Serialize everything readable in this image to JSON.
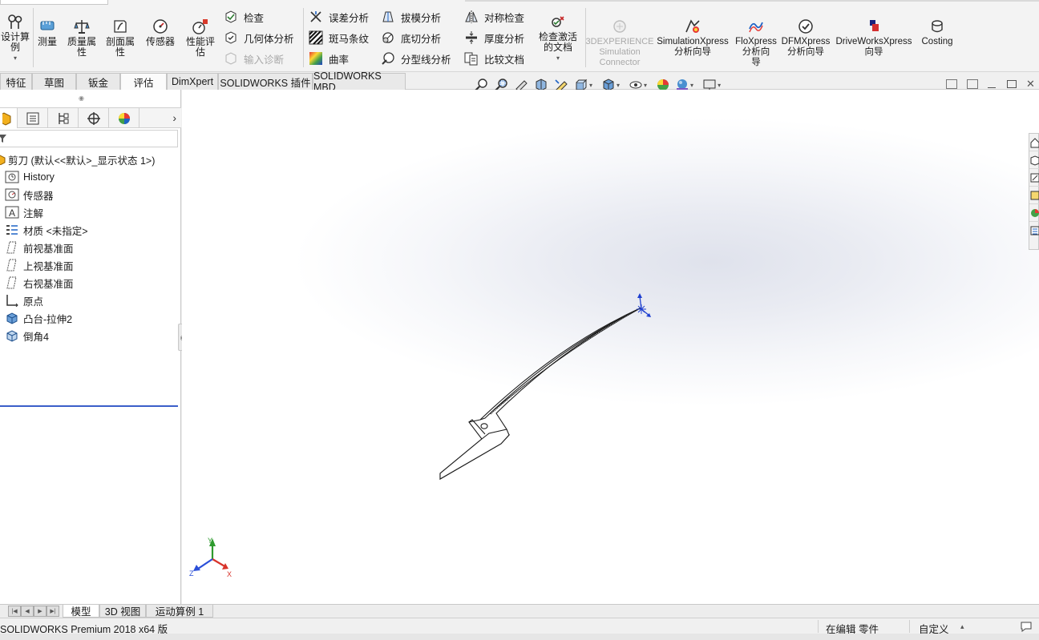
{
  "ribbon": {
    "large_buttons": [
      {
        "label": "设计算\n例",
        "icon": "design-study-icon"
      },
      {
        "label": "测量",
        "icon": "measure-icon"
      },
      {
        "label": "质量属\n性",
        "icon": "mass-properties-icon"
      },
      {
        "label": "剖面属\n性",
        "icon": "section-properties-icon"
      },
      {
        "label": "传感器",
        "icon": "sensor-icon"
      },
      {
        "label": "性能评\n估",
        "icon": "performance-evaluation-icon"
      }
    ],
    "small_buttons": [
      {
        "label": "检查",
        "icon": "check-icon",
        "enabled": true
      },
      {
        "label": "几何体分析",
        "icon": "geometry-analysis-icon",
        "enabled": true
      },
      {
        "label": "输入诊断",
        "icon": "import-diagnostics-icon",
        "enabled": false
      },
      {
        "label": "误差分析",
        "icon": "deviation-analysis-icon",
        "enabled": true
      },
      {
        "label": "斑马条纹",
        "icon": "zebra-stripes-icon",
        "enabled": true
      },
      {
        "label": "曲率",
        "icon": "curvature-icon",
        "enabled": true
      },
      {
        "label": "拔模分析",
        "icon": "draft-analysis-icon",
        "enabled": true
      },
      {
        "label": "底切分析",
        "icon": "undercut-analysis-icon",
        "enabled": true
      },
      {
        "label": "分型线分析",
        "icon": "parting-line-analysis-icon",
        "enabled": true
      },
      {
        "label": "对称检查",
        "icon": "symmetry-check-icon",
        "enabled": true
      },
      {
        "label": "厚度分析",
        "icon": "thickness-analysis-icon",
        "enabled": true
      },
      {
        "label": "比较文档",
        "icon": "compare-documents-icon",
        "enabled": true
      }
    ],
    "check_active_doc": "检查激活\n的文档",
    "right_buttons": [
      {
        "label": "3DEXPERIENCE\nSimulation\nConnector",
        "icon": "3dexperience-icon",
        "enabled": false
      },
      {
        "label": "SimulationXpress\n分析向导",
        "icon": "simulationxpress-icon",
        "enabled": true
      },
      {
        "label": "FloXpress\n分析向\n导",
        "icon": "floxpress-icon",
        "enabled": true
      },
      {
        "label": "DFMXpress\n分析向导",
        "icon": "dfmxpress-icon",
        "enabled": true
      },
      {
        "label": "DriveWorksXpress\n向导",
        "icon": "driveworksxpress-icon",
        "enabled": true
      },
      {
        "label": "Costing",
        "icon": "costing-icon",
        "enabled": true
      }
    ]
  },
  "tabs": [
    "特征",
    "草图",
    "钣金",
    "评估",
    "DimXpert",
    "SOLIDWORKS 插件",
    "SOLIDWORKS MBD"
  ],
  "active_tab": "评估",
  "tree": {
    "root": "剪刀 (默认<<默认>_显示状态 1>)",
    "items": [
      {
        "label": "History",
        "icon": "history-icon"
      },
      {
        "label": "传感器",
        "icon": "sensor-folder-icon"
      },
      {
        "label": "注解",
        "icon": "annotations-icon"
      },
      {
        "label": "材质 <未指定>",
        "icon": "material-icon"
      },
      {
        "label": "前视基准面",
        "icon": "front-plane-icon"
      },
      {
        "label": "上视基准面",
        "icon": "top-plane-icon"
      },
      {
        "label": "右视基准面",
        "icon": "right-plane-icon"
      },
      {
        "label": "原点",
        "icon": "origin-icon"
      },
      {
        "label": "凸台-拉伸2",
        "icon": "boss-extrude-icon"
      },
      {
        "label": "倒角4",
        "icon": "chamfer-icon"
      }
    ]
  },
  "triad": {
    "x": "X",
    "y": "Y",
    "z": "Z"
  },
  "bottom_tabs": [
    "模型",
    "3D 视图",
    "运动算例 1"
  ],
  "active_bottom_tab": "模型",
  "status": {
    "product": "SOLIDWORKS Premium 2018 x64 版",
    "editing": "在编辑 零件",
    "units": "自定义"
  }
}
